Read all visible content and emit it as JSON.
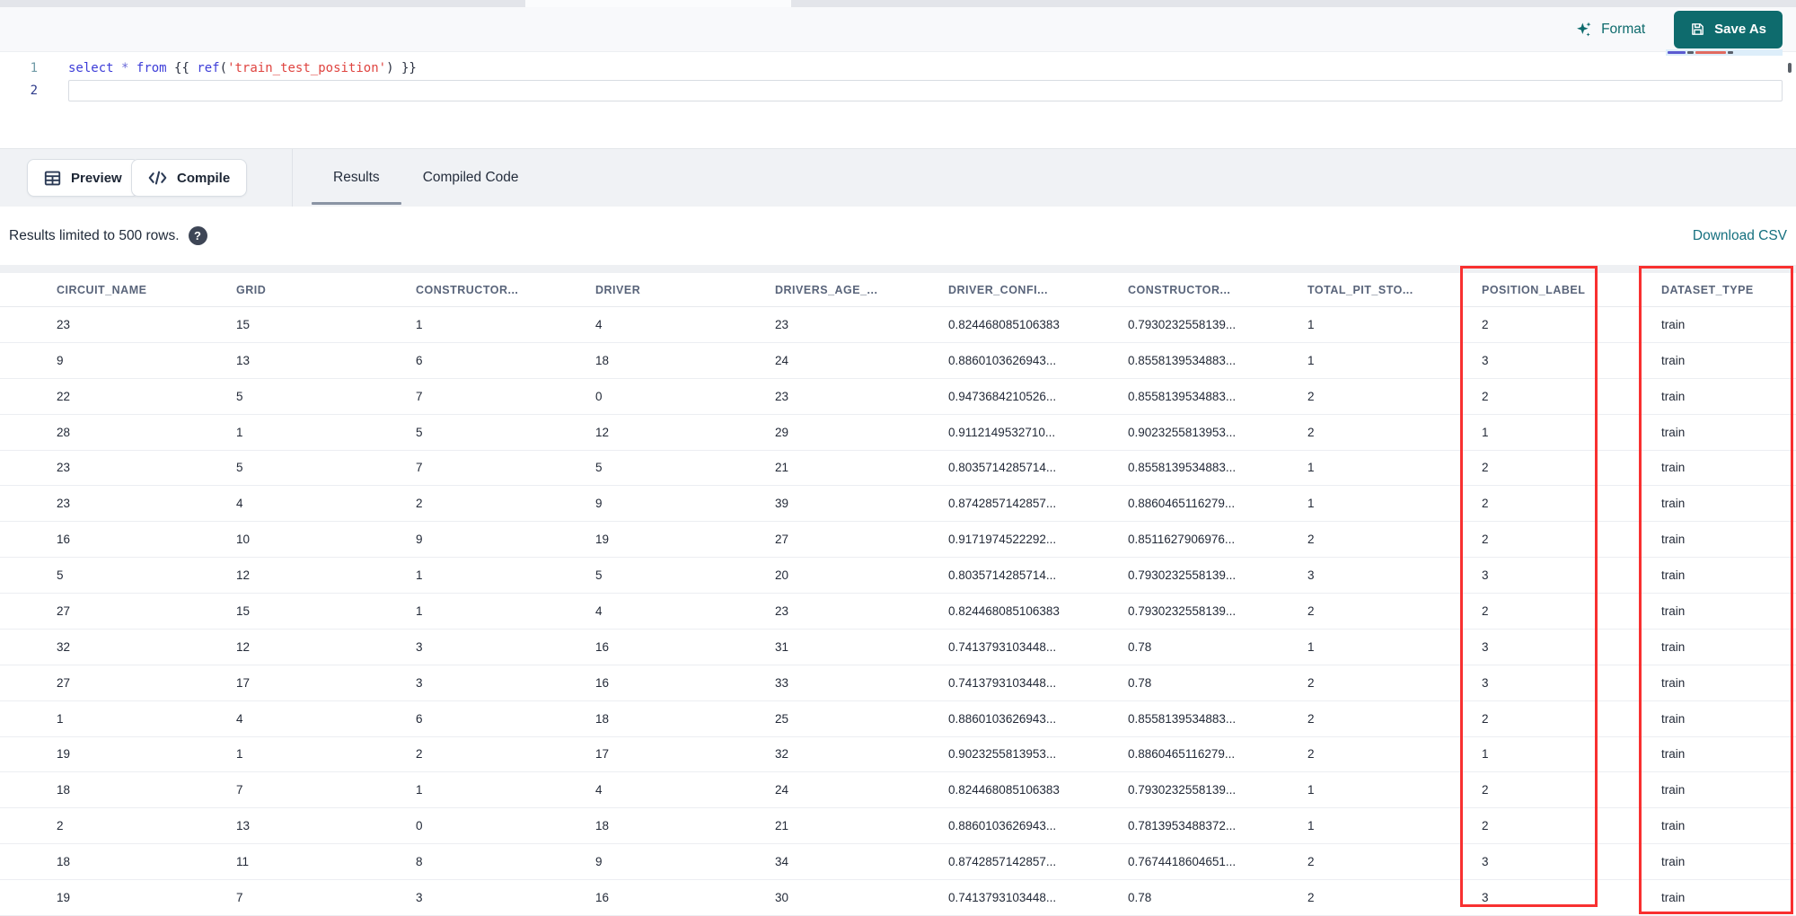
{
  "colors": {
    "accent_teal": "#0e6b6d",
    "link_teal": "#15707f",
    "annotation_red": "#f83030",
    "keyword_blue": "#3d3dd8",
    "operator_blue": "#6a6ad8",
    "string_red": "#df4440",
    "line_number_default": "#6f9aa6",
    "line_number_active": "#2d3a8a"
  },
  "editor_toolbar": {
    "format_label": "Format",
    "save_as_label": "Save As"
  },
  "editor": {
    "lines": [
      {
        "number": "1",
        "tokens": [
          {
            "t": "select",
            "c": "kw"
          },
          {
            "t": " ",
            "c": "pl"
          },
          {
            "t": "*",
            "c": "op"
          },
          {
            "t": " ",
            "c": "pl"
          },
          {
            "t": "from",
            "c": "kw"
          },
          {
            "t": " {{ ",
            "c": "pl"
          },
          {
            "t": "ref",
            "c": "fn"
          },
          {
            "t": "(",
            "c": "pl"
          },
          {
            "t": "'train_test_position'",
            "c": "str"
          },
          {
            "t": ")",
            "c": "pl"
          },
          {
            "t": " }}",
            "c": "pl"
          }
        ]
      },
      {
        "number": "2",
        "tokens": []
      }
    ]
  },
  "results_panel": {
    "preview_label": "Preview",
    "compile_label": "Compile",
    "tabs": [
      {
        "label": "Results",
        "active": true
      },
      {
        "label": "Compiled Code",
        "active": false
      }
    ],
    "limit_notice": "Results limited to 500 rows.",
    "help_icon_glyph": "?",
    "download_csv_label": "Download CSV"
  },
  "table": {
    "columns": [
      "CIRCUIT_NAME",
      "GRID",
      "CONSTRUCTOR...",
      "DRIVER",
      "DRIVERS_AGE_...",
      "DRIVER_CONFI...",
      "CONSTRUCTOR...",
      "TOTAL_PIT_STO...",
      "POSITION_LABEL",
      "DATASET_TYPE"
    ],
    "highlighted_columns": [
      "POSITION_LABEL",
      "DATASET_TYPE"
    ],
    "rows": [
      [
        "23",
        "15",
        "1",
        "4",
        "23",
        "0.824468085106383",
        "0.7930232558139...",
        "1",
        "2",
        "train"
      ],
      [
        "9",
        "13",
        "6",
        "18",
        "24",
        "0.8860103626943...",
        "0.8558139534883...",
        "1",
        "3",
        "train"
      ],
      [
        "22",
        "5",
        "7",
        "0",
        "23",
        "0.9473684210526...",
        "0.8558139534883...",
        "2",
        "2",
        "train"
      ],
      [
        "28",
        "1",
        "5",
        "12",
        "29",
        "0.9112149532710...",
        "0.9023255813953...",
        "2",
        "1",
        "train"
      ],
      [
        "23",
        "5",
        "7",
        "5",
        "21",
        "0.8035714285714...",
        "0.8558139534883...",
        "1",
        "2",
        "train"
      ],
      [
        "23",
        "4",
        "2",
        "9",
        "39",
        "0.8742857142857...",
        "0.8860465116279...",
        "1",
        "2",
        "train"
      ],
      [
        "16",
        "10",
        "9",
        "19",
        "27",
        "0.9171974522292...",
        "0.8511627906976...",
        "2",
        "2",
        "train"
      ],
      [
        "5",
        "12",
        "1",
        "5",
        "20",
        "0.8035714285714...",
        "0.7930232558139...",
        "3",
        "3",
        "train"
      ],
      [
        "27",
        "15",
        "1",
        "4",
        "23",
        "0.824468085106383",
        "0.7930232558139...",
        "2",
        "2",
        "train"
      ],
      [
        "32",
        "12",
        "3",
        "16",
        "31",
        "0.7413793103448...",
        "0.78",
        "1",
        "3",
        "train"
      ],
      [
        "27",
        "17",
        "3",
        "16",
        "33",
        "0.7413793103448...",
        "0.78",
        "2",
        "3",
        "train"
      ],
      [
        "1",
        "4",
        "6",
        "18",
        "25",
        "0.8860103626943...",
        "0.8558139534883...",
        "2",
        "2",
        "train"
      ],
      [
        "19",
        "1",
        "2",
        "17",
        "32",
        "0.9023255813953...",
        "0.8860465116279...",
        "2",
        "1",
        "train"
      ],
      [
        "18",
        "7",
        "1",
        "4",
        "24",
        "0.824468085106383",
        "0.7930232558139...",
        "1",
        "2",
        "train"
      ],
      [
        "2",
        "13",
        "0",
        "18",
        "21",
        "0.8860103626943...",
        "0.7813953488372...",
        "1",
        "2",
        "train"
      ],
      [
        "18",
        "11",
        "8",
        "9",
        "34",
        "0.8742857142857...",
        "0.7674418604651...",
        "2",
        "3",
        "train"
      ],
      [
        "19",
        "7",
        "3",
        "16",
        "30",
        "0.7413793103448...",
        "0.78",
        "2",
        "3",
        "train"
      ]
    ]
  }
}
